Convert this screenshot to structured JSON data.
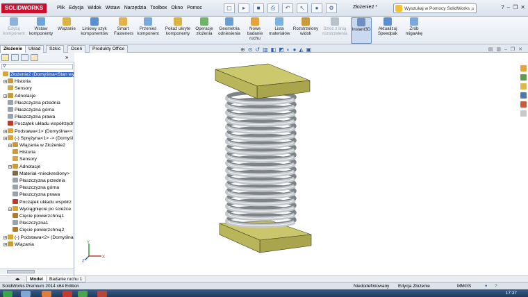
{
  "app": {
    "logo": "SOLIDWORKS",
    "document_title": "Złożenie2 *"
  },
  "menu": [
    "Plik",
    "Edycja",
    "Widok",
    "Wstaw",
    "Narzędzia",
    "Toolbox",
    "Okno",
    "Pomoc"
  ],
  "search": {
    "placeholder": "Wyszukaj w Pomocy SolidWorks"
  },
  "ribbon": [
    {
      "label": "Edytuj komponent",
      "enabled": false
    },
    {
      "label": "Wstaw komponenty",
      "enabled": true
    },
    {
      "label": "Wiązanie",
      "enabled": true
    },
    {
      "label": "Liniowy szyk komponentów",
      "enabled": true
    },
    {
      "label": "Smart Fasteners",
      "enabled": true
    },
    {
      "label": "Przenieś komponent",
      "enabled": true
    },
    {
      "label": "Pokaż ukryte komponenty",
      "enabled": true
    },
    {
      "label": "Operacje złożenia",
      "enabled": true
    },
    {
      "label": "Geometria odniesienia",
      "enabled": true
    },
    {
      "label": "Nowe badanie ruchu",
      "enabled": true
    },
    {
      "label": "Lista materiałów",
      "enabled": true
    },
    {
      "label": "Rozstrzelony widok",
      "enabled": true
    },
    {
      "label": "Szkic z linią rozstrzelenia",
      "enabled": false
    },
    {
      "label": "Instant3D",
      "enabled": true,
      "active": true
    },
    {
      "label": "Aktualizuj Speedpak",
      "enabled": true
    },
    {
      "label": "Zrób migawkę",
      "enabled": true
    }
  ],
  "cmd_tabs": [
    "Złożenie",
    "Układ",
    "Szkic",
    "Oceń",
    "Produkty Office"
  ],
  "tree": [
    {
      "label": "Złożenie2 (Domyślna<Stan wyś",
      "indent": 0,
      "selected": true,
      "icon": "assembly-icon",
      "color": "#d9a62e"
    },
    {
      "label": "Historia",
      "indent": 1,
      "icon": "history-icon",
      "color": "#c99a3b"
    },
    {
      "label": "Sensory",
      "indent": 1,
      "icon": "sensor-icon",
      "color": "#d3a648"
    },
    {
      "label": "Adnotacje",
      "indent": 1,
      "icon": "annotation-icon",
      "color": "#c99a3b"
    },
    {
      "label": "Płaszczyzna przednia",
      "indent": 1,
      "icon": "plane-icon",
      "color": "#9aa3ad"
    },
    {
      "label": "Płaszczyzna górna",
      "indent": 1,
      "icon": "plane-icon",
      "color": "#9aa3ad"
    },
    {
      "label": "Płaszczyzna prawa",
      "indent": 1,
      "icon": "plane-icon",
      "color": "#9aa3ad"
    },
    {
      "label": "Początek układu współrzędn",
      "indent": 1,
      "icon": "origin-icon",
      "color": "#c0392b"
    },
    {
      "label": "Podstawa<1> (Domyślna<<",
      "indent": 1,
      "icon": "part-icon",
      "color": "#d9a62e"
    },
    {
      "label": "(-) Sprężyna<1> -> (Domyśl",
      "indent": 1,
      "icon": "part-icon",
      "color": "#d9a62e"
    },
    {
      "label": "Wiązania w Złożenie2",
      "indent": 2,
      "icon": "mates-icon",
      "color": "#c99a3b"
    },
    {
      "label": "Historia",
      "indent": 2,
      "icon": "history-icon",
      "color": "#c99a3b"
    },
    {
      "label": "Sensory",
      "indent": 2,
      "icon": "sensor-icon",
      "color": "#d3a648"
    },
    {
      "label": "Adnotacje",
      "indent": 2,
      "icon": "annotation-icon",
      "color": "#c99a3b"
    },
    {
      "label": "Materiał <nieokreślony>",
      "indent": 2,
      "icon": "material-icon",
      "color": "#7d6b52"
    },
    {
      "label": "Płaszczyzna przednia",
      "indent": 2,
      "icon": "plane-icon",
      "color": "#9aa3ad"
    },
    {
      "label": "Płaszczyzna górna",
      "indent": 2,
      "icon": "plane-icon",
      "color": "#9aa3ad"
    },
    {
      "label": "Płaszczyzna prawa",
      "indent": 2,
      "icon": "plane-icon",
      "color": "#9aa3ad"
    },
    {
      "label": "Początek układu współrz",
      "indent": 2,
      "icon": "origin-icon",
      "color": "#c0392b"
    },
    {
      "label": "Wyciągnięcie po ścieżce",
      "indent": 2,
      "icon": "sweep-icon",
      "color": "#d9a62e"
    },
    {
      "label": "Cięcie powierzchnią1",
      "indent": 2,
      "icon": "cut-icon",
      "color": "#b07c2a"
    },
    {
      "label": "Płaszczyzna1",
      "indent": 2,
      "icon": "plane-icon",
      "color": "#9aa3ad"
    },
    {
      "label": "Cięcie powierzchnią2",
      "indent": 2,
      "icon": "cut-icon",
      "color": "#b07c2a"
    },
    {
      "label": "(-) Podstawa<2> (Domyślna",
      "indent": 1,
      "icon": "part-icon",
      "color": "#d9a62e"
    },
    {
      "label": "Wiązania",
      "indent": 1,
      "icon": "mates-icon",
      "color": "#c99a3b"
    }
  ],
  "bottom_tabs": [
    "Model",
    "Badanie ruchu 1"
  ],
  "status": {
    "product": "SolidWorks Premium 2014 x64 Edition",
    "definition": "Niedodefiniowany",
    "mode": "Edycja Złożenie",
    "units": "MMGS",
    "clock": "17:37"
  },
  "colors": {
    "base_plate": "#c8c46a",
    "spring": "#b4b8bc",
    "selection": "#3168c5",
    "taskbar": "#1f3a5c",
    "accent": "#c8102e"
  }
}
